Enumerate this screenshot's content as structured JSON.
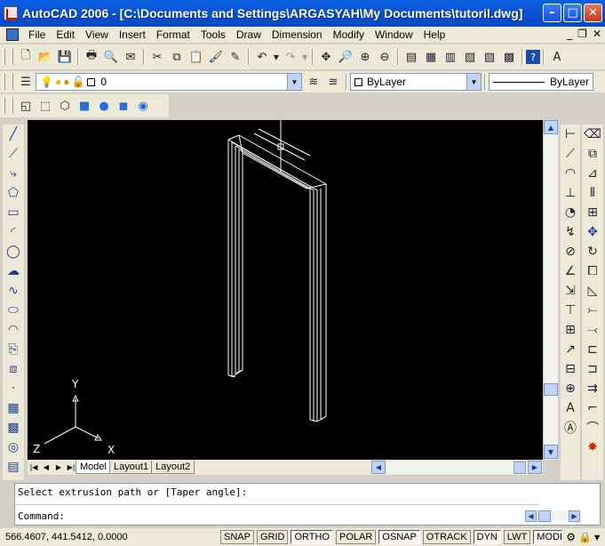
{
  "window": {
    "title": "AutoCAD 2006 - [C:\\Documents and Settings\\ARGASYAH\\My Documents\\tutoril.dwg]"
  },
  "menu": [
    "File",
    "Edit",
    "View",
    "Insert",
    "Format",
    "Tools",
    "Draw",
    "Dimension",
    "Modify",
    "Window",
    "Help"
  ],
  "layer_toolbar": {
    "current_layer": "0",
    "color": "ByLayer",
    "linetype": "ByLayer"
  },
  "tabs": [
    "Model",
    "Layout1",
    "Layout2"
  ],
  "active_tab": "Model",
  "ucs": {
    "x_label": "X",
    "y_label": "Y",
    "z_label": "Z"
  },
  "command_lines": [
    "Select extrusion path or [Taper angle]:",
    "Command:"
  ],
  "status": {
    "coords": "566.4607, 441.5412, 0.0000",
    "buttons": [
      "SNAP",
      "GRID",
      "ORTHO",
      "POLAR",
      "OSNAP",
      "OTRACK",
      "DYN",
      "LWT",
      "MODEL"
    ],
    "pressed": [
      "ORTHO",
      "OSNAP",
      "DYN",
      "MODEL"
    ]
  },
  "colors": {
    "titlebar": "#0954d8",
    "canvas": "#000000",
    "wire": "#ffffff"
  }
}
